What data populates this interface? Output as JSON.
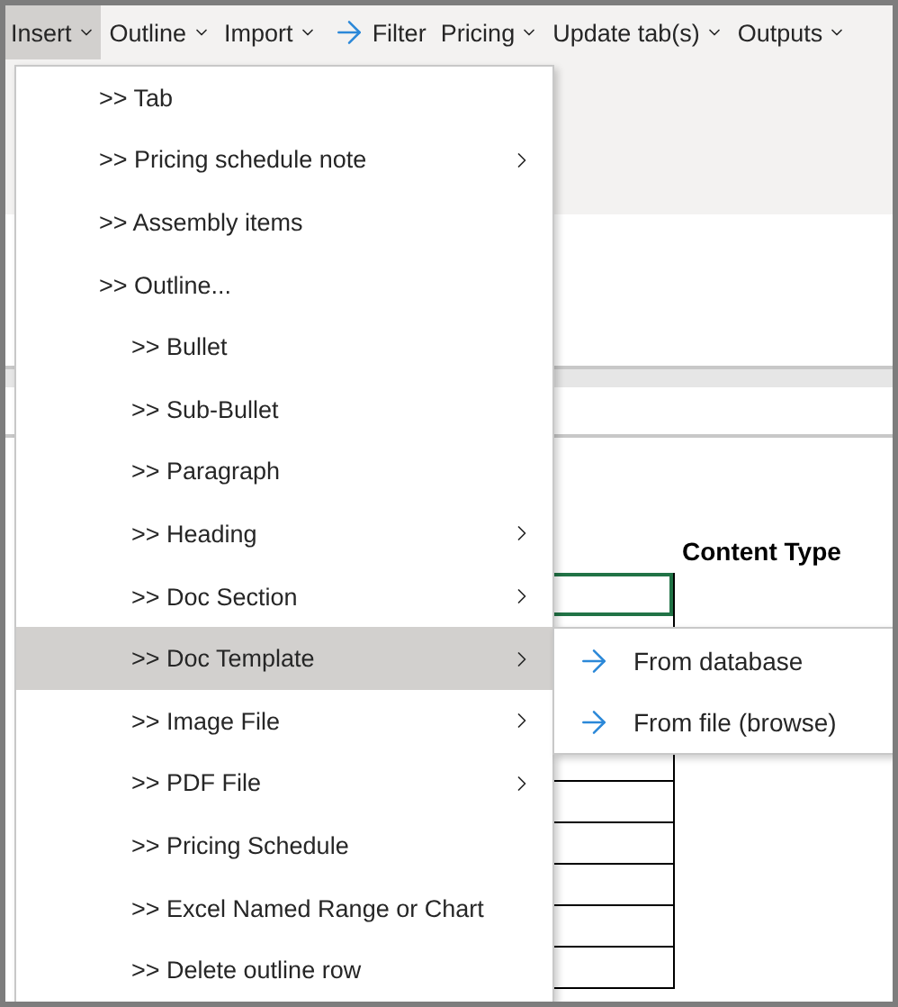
{
  "menubar": [
    {
      "label": "Insert",
      "kind": "dropdown",
      "selected": true
    },
    {
      "label": "Outline",
      "kind": "dropdown",
      "selected": false
    },
    {
      "label": "Import",
      "kind": "dropdown",
      "selected": false
    },
    {
      "label": "Filter",
      "kind": "action",
      "selected": false
    },
    {
      "label": "Pricing",
      "kind": "dropdown",
      "selected": false
    },
    {
      "label": "Update tab(s)",
      "kind": "dropdown",
      "selected": false
    },
    {
      "label": "Outputs",
      "kind": "dropdown",
      "selected": false
    }
  ],
  "menu": [
    {
      "label": ">> Tab",
      "submenu_arrow": false,
      "selected": false
    },
    {
      "label": ">> Pricing schedule note",
      "submenu_arrow": true,
      "selected": false
    },
    {
      "label": ">> Assembly items",
      "submenu_arrow": false,
      "selected": false
    },
    {
      "label": ">> Outline...",
      "submenu_arrow": false,
      "selected": false,
      "children": [
        {
          "label": ">> Bullet",
          "submenu_arrow": false,
          "selected": false
        },
        {
          "label": ">> Sub-Bullet",
          "submenu_arrow": false,
          "selected": false
        },
        {
          "label": ">> Paragraph",
          "submenu_arrow": false,
          "selected": false
        },
        {
          "label": ">> Heading",
          "submenu_arrow": true,
          "selected": false
        },
        {
          "label": ">> Doc Section",
          "submenu_arrow": true,
          "selected": false
        },
        {
          "label": ">> Doc Template",
          "submenu_arrow": true,
          "selected": true,
          "submenu": [
            {
              "label": "From database"
            },
            {
              "label": "From file (browse)"
            }
          ]
        },
        {
          "label": ">> Image File",
          "submenu_arrow": true,
          "selected": false
        },
        {
          "label": ">> PDF File",
          "submenu_arrow": true,
          "selected": false
        },
        {
          "label": ">> Pricing Schedule",
          "submenu_arrow": false,
          "selected": false
        },
        {
          "label": ">> Excel Named Range or Chart",
          "submenu_arrow": false,
          "selected": false
        },
        {
          "label": ">> Delete outline row",
          "submenu_arrow": false,
          "selected": false
        }
      ]
    }
  ],
  "sheet": {
    "column_header": "Content Type",
    "cells": [
      {
        "selected": true
      },
      {
        "selected": false
      },
      {
        "selected": false
      },
      {
        "selected": false
      },
      {
        "selected": false
      },
      {
        "selected": false
      },
      {
        "selected": false
      }
    ]
  }
}
